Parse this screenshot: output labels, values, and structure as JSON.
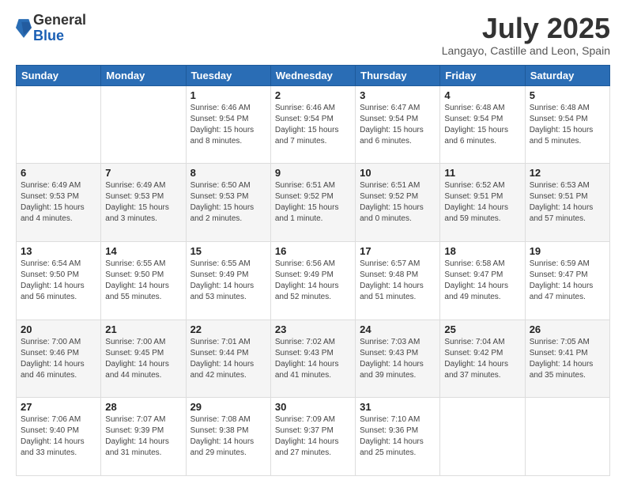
{
  "logo": {
    "general": "General",
    "blue": "Blue"
  },
  "title": "July 2025",
  "location": "Langayo, Castille and Leon, Spain",
  "weekdays": [
    "Sunday",
    "Monday",
    "Tuesday",
    "Wednesday",
    "Thursday",
    "Friday",
    "Saturday"
  ],
  "weeks": [
    [
      {
        "day": "",
        "sunrise": "",
        "sunset": "",
        "daylight": ""
      },
      {
        "day": "",
        "sunrise": "",
        "sunset": "",
        "daylight": ""
      },
      {
        "day": "1",
        "sunrise": "Sunrise: 6:46 AM",
        "sunset": "Sunset: 9:54 PM",
        "daylight": "Daylight: 15 hours and 8 minutes."
      },
      {
        "day": "2",
        "sunrise": "Sunrise: 6:46 AM",
        "sunset": "Sunset: 9:54 PM",
        "daylight": "Daylight: 15 hours and 7 minutes."
      },
      {
        "day": "3",
        "sunrise": "Sunrise: 6:47 AM",
        "sunset": "Sunset: 9:54 PM",
        "daylight": "Daylight: 15 hours and 6 minutes."
      },
      {
        "day": "4",
        "sunrise": "Sunrise: 6:48 AM",
        "sunset": "Sunset: 9:54 PM",
        "daylight": "Daylight: 15 hours and 6 minutes."
      },
      {
        "day": "5",
        "sunrise": "Sunrise: 6:48 AM",
        "sunset": "Sunset: 9:54 PM",
        "daylight": "Daylight: 15 hours and 5 minutes."
      }
    ],
    [
      {
        "day": "6",
        "sunrise": "Sunrise: 6:49 AM",
        "sunset": "Sunset: 9:53 PM",
        "daylight": "Daylight: 15 hours and 4 minutes."
      },
      {
        "day": "7",
        "sunrise": "Sunrise: 6:49 AM",
        "sunset": "Sunset: 9:53 PM",
        "daylight": "Daylight: 15 hours and 3 minutes."
      },
      {
        "day": "8",
        "sunrise": "Sunrise: 6:50 AM",
        "sunset": "Sunset: 9:53 PM",
        "daylight": "Daylight: 15 hours and 2 minutes."
      },
      {
        "day": "9",
        "sunrise": "Sunrise: 6:51 AM",
        "sunset": "Sunset: 9:52 PM",
        "daylight": "Daylight: 15 hours and 1 minute."
      },
      {
        "day": "10",
        "sunrise": "Sunrise: 6:51 AM",
        "sunset": "Sunset: 9:52 PM",
        "daylight": "Daylight: 15 hours and 0 minutes."
      },
      {
        "day": "11",
        "sunrise": "Sunrise: 6:52 AM",
        "sunset": "Sunset: 9:51 PM",
        "daylight": "Daylight: 14 hours and 59 minutes."
      },
      {
        "day": "12",
        "sunrise": "Sunrise: 6:53 AM",
        "sunset": "Sunset: 9:51 PM",
        "daylight": "Daylight: 14 hours and 57 minutes."
      }
    ],
    [
      {
        "day": "13",
        "sunrise": "Sunrise: 6:54 AM",
        "sunset": "Sunset: 9:50 PM",
        "daylight": "Daylight: 14 hours and 56 minutes."
      },
      {
        "day": "14",
        "sunrise": "Sunrise: 6:55 AM",
        "sunset": "Sunset: 9:50 PM",
        "daylight": "Daylight: 14 hours and 55 minutes."
      },
      {
        "day": "15",
        "sunrise": "Sunrise: 6:55 AM",
        "sunset": "Sunset: 9:49 PM",
        "daylight": "Daylight: 14 hours and 53 minutes."
      },
      {
        "day": "16",
        "sunrise": "Sunrise: 6:56 AM",
        "sunset": "Sunset: 9:49 PM",
        "daylight": "Daylight: 14 hours and 52 minutes."
      },
      {
        "day": "17",
        "sunrise": "Sunrise: 6:57 AM",
        "sunset": "Sunset: 9:48 PM",
        "daylight": "Daylight: 14 hours and 51 minutes."
      },
      {
        "day": "18",
        "sunrise": "Sunrise: 6:58 AM",
        "sunset": "Sunset: 9:47 PM",
        "daylight": "Daylight: 14 hours and 49 minutes."
      },
      {
        "day": "19",
        "sunrise": "Sunrise: 6:59 AM",
        "sunset": "Sunset: 9:47 PM",
        "daylight": "Daylight: 14 hours and 47 minutes."
      }
    ],
    [
      {
        "day": "20",
        "sunrise": "Sunrise: 7:00 AM",
        "sunset": "Sunset: 9:46 PM",
        "daylight": "Daylight: 14 hours and 46 minutes."
      },
      {
        "day": "21",
        "sunrise": "Sunrise: 7:00 AM",
        "sunset": "Sunset: 9:45 PM",
        "daylight": "Daylight: 14 hours and 44 minutes."
      },
      {
        "day": "22",
        "sunrise": "Sunrise: 7:01 AM",
        "sunset": "Sunset: 9:44 PM",
        "daylight": "Daylight: 14 hours and 42 minutes."
      },
      {
        "day": "23",
        "sunrise": "Sunrise: 7:02 AM",
        "sunset": "Sunset: 9:43 PM",
        "daylight": "Daylight: 14 hours and 41 minutes."
      },
      {
        "day": "24",
        "sunrise": "Sunrise: 7:03 AM",
        "sunset": "Sunset: 9:43 PM",
        "daylight": "Daylight: 14 hours and 39 minutes."
      },
      {
        "day": "25",
        "sunrise": "Sunrise: 7:04 AM",
        "sunset": "Sunset: 9:42 PM",
        "daylight": "Daylight: 14 hours and 37 minutes."
      },
      {
        "day": "26",
        "sunrise": "Sunrise: 7:05 AM",
        "sunset": "Sunset: 9:41 PM",
        "daylight": "Daylight: 14 hours and 35 minutes."
      }
    ],
    [
      {
        "day": "27",
        "sunrise": "Sunrise: 7:06 AM",
        "sunset": "Sunset: 9:40 PM",
        "daylight": "Daylight: 14 hours and 33 minutes."
      },
      {
        "day": "28",
        "sunrise": "Sunrise: 7:07 AM",
        "sunset": "Sunset: 9:39 PM",
        "daylight": "Daylight: 14 hours and 31 minutes."
      },
      {
        "day": "29",
        "sunrise": "Sunrise: 7:08 AM",
        "sunset": "Sunset: 9:38 PM",
        "daylight": "Daylight: 14 hours and 29 minutes."
      },
      {
        "day": "30",
        "sunrise": "Sunrise: 7:09 AM",
        "sunset": "Sunset: 9:37 PM",
        "daylight": "Daylight: 14 hours and 27 minutes."
      },
      {
        "day": "31",
        "sunrise": "Sunrise: 7:10 AM",
        "sunset": "Sunset: 9:36 PM",
        "daylight": "Daylight: 14 hours and 25 minutes."
      },
      {
        "day": "",
        "sunrise": "",
        "sunset": "",
        "daylight": ""
      },
      {
        "day": "",
        "sunrise": "",
        "sunset": "",
        "daylight": ""
      }
    ]
  ]
}
